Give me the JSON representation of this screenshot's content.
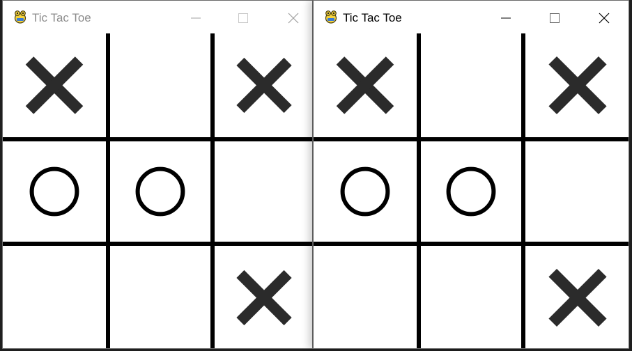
{
  "windows": [
    {
      "title": "Tic Tac Toe",
      "state": "inactive",
      "app_icon": "pygame-snake-icon",
      "controls": [
        "minimize",
        "maximize",
        "close"
      ],
      "board": [
        [
          "X",
          "",
          "X"
        ],
        [
          "O",
          "O",
          ""
        ],
        [
          "",
          "",
          "X"
        ]
      ]
    },
    {
      "title": "Tic Tac Toe",
      "state": "active",
      "app_icon": "pygame-snake-icon",
      "controls": [
        "minimize",
        "maximize",
        "close"
      ],
      "board": [
        [
          "X",
          "",
          "X"
        ],
        [
          "O",
          "O",
          ""
        ],
        [
          "",
          "",
          "X"
        ]
      ]
    }
  ],
  "colors": {
    "board_background": "#ffffff",
    "grid_line": "#000000",
    "x_mark": "#2b2b2b",
    "o_mark": "#000000",
    "inactive_title": "#8c8c8c",
    "active_title": "#000000"
  }
}
